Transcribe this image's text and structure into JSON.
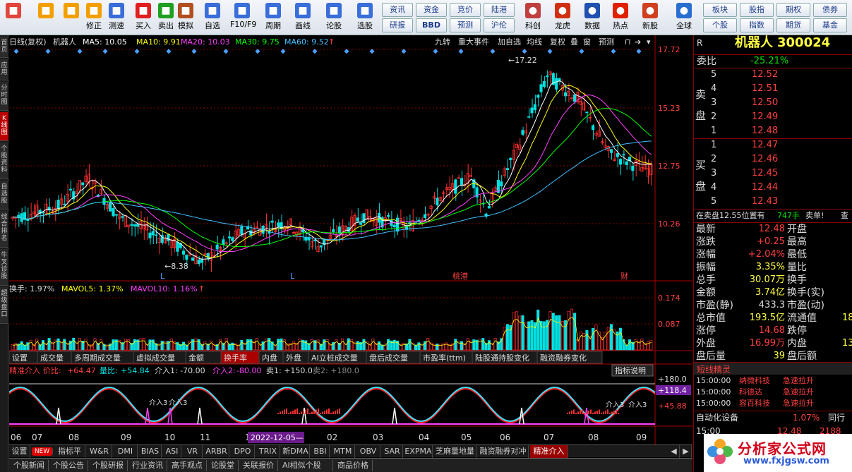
{
  "toolbar": {
    "buttons": [
      {
        "label": "",
        "icon": "app-grid-icon",
        "color": "#e2453c"
      },
      {
        "label": "",
        "icon": "back-arrow-icon",
        "color": "#f2a000"
      },
      {
        "label": "",
        "icon": "up-down-arrow-icon",
        "color": "#f2a000"
      },
      {
        "label": "修正",
        "icon": "refresh-icon",
        "color": "#f2a000"
      },
      {
        "label": "测速",
        "icon": "clock-icon",
        "color": "#3a6ed8"
      },
      {
        "label": "买入",
        "icon": "buy-icon",
        "color": "#e02020"
      },
      {
        "label": "卖出",
        "icon": "sell-icon",
        "color": "#20a020"
      },
      {
        "label": "模拟",
        "icon": "hammer-icon",
        "color": "#b05020"
      },
      {
        "label": "自选",
        "icon": "star-folder-icon",
        "color": "#3a6ed8"
      },
      {
        "label": "F10/F9",
        "icon": "f10-icon",
        "color": "#3a6ed8"
      },
      {
        "label": "周期",
        "icon": "period-icon",
        "color": "#3a6ed8"
      },
      {
        "label": "画线",
        "icon": "pencil-icon",
        "color": "#3a6ed8"
      },
      {
        "label": "论股",
        "icon": "discuss-icon",
        "color": "#3a6ed8"
      },
      {
        "label": "选股",
        "icon": "stock-pick-icon",
        "color": "#3a6ed8"
      }
    ],
    "tags_row1": [
      "资讯",
      "资金",
      "竞价",
      "陆港"
    ],
    "tags_row2": [
      "研报",
      "BBD",
      "预测",
      "沪伦"
    ],
    "buttons2": [
      {
        "label": "科创",
        "icon": "tech-board-icon"
      },
      {
        "label": "龙虎",
        "icon": "dragon-tiger-icon"
      },
      {
        "label": "数据",
        "icon": "pe-data-icon"
      },
      {
        "label": "热点",
        "icon": "hot-icon"
      },
      {
        "label": "新股",
        "icon": "new-stock-icon"
      },
      {
        "label": "全球",
        "icon": "globe-icon"
      }
    ],
    "tags2_row1": [
      "板块",
      "股指",
      "期权",
      "债券"
    ],
    "tags2_row2": [
      "个股",
      "指数",
      "期货",
      "基金"
    ]
  },
  "left_tabs": [
    "首页",
    "应用",
    "分时图",
    "K线图",
    "个股资料",
    "自选股",
    "综合排名",
    "牛叉诊股",
    "超级盘口"
  ],
  "chart": {
    "header_left": "日线(复权)",
    "stock_name": "机器人",
    "ma5": "MA5: 10.05",
    "ma10": "MA10: 9.91",
    "ma20": "MA20: 10.03",
    "ma30": "MA30: 9.75",
    "ma60": "MA60: 9.52",
    "header_right": [
      "九转",
      "重大事件",
      "加自选",
      "均线",
      "复权",
      "叠",
      "窗",
      "预测"
    ],
    "price_axis": [
      "17.72",
      "15.23",
      "12.75",
      "10.26"
    ],
    "high_label": "17.22",
    "low_label": "8.38",
    "markers": [
      "L",
      "L",
      "桃港",
      "财"
    ],
    "colors": {
      "ma5": "#ffffff",
      "ma10": "#ffff00",
      "ma20": "#ff40ff",
      "ma30": "#00ff00",
      "ma60": "#40c0ff",
      "up": "#ff3030",
      "down": "#00e0e0"
    }
  },
  "volume": {
    "label": "换手: 1.97%",
    "mavol5": "MAVOL5: 1.37%",
    "mavol10": "MAVOL10: 1.16%",
    "axis": [
      "0.174",
      "0.087"
    ]
  },
  "subtabs": [
    "设置",
    "成交量",
    "多周期成交量",
    "虚拟成交量",
    "金额",
    "换手率",
    "内盘",
    "外盘",
    "AI立桩成交量",
    "盘后成交量",
    "市盈率(ttm)",
    "陆股通持股变化",
    "融资融券变化"
  ],
  "indicator": {
    "name": "精准介入",
    "price_ratio_label": "价比:",
    "price_ratio": "+64.47",
    "vol_ratio_label": "量比:",
    "vol_ratio": "+54.84",
    "entry1": "介入1: -70.00",
    "entry2_label": "介入2:",
    "entry2": "-80.00",
    "sell1": "卖1: +150.0",
    "sell2": "卖2: +180.0",
    "explain": "指标说明",
    "axis": [
      "+180.0",
      "+118.4",
      "+45.88"
    ],
    "annotation": "介入3"
  },
  "time_axis": [
    "06",
    "07",
    "08",
    "09",
    "10",
    "11",
    "12",
    "01",
    "02",
    "03",
    "04",
    "05",
    "06",
    "07",
    "08",
    "09"
  ],
  "date_tooltip": "2022-12-05",
  "bottom_tabs": [
    "设置",
    "NEW",
    "指标平台",
    "W&R",
    "DMI",
    "BIAS",
    "ASI",
    "VR",
    "ARBR",
    "DPO",
    "TRIX",
    "新DMA",
    "BBI",
    "MTM",
    "OBV",
    "SAR",
    "EXPMA",
    "芝麻量地量",
    "融资融券对冲",
    "精准介入"
  ],
  "bottom2": [
    "个股新闻",
    "个股公告",
    "个股研报",
    "行业资讯",
    "高手观点",
    "论股堂",
    "关联报价",
    "AI相似个股",
    "商品价格"
  ],
  "right": {
    "r": "R",
    "name": "机器人",
    "code": "300024",
    "weibi_label": "委比",
    "weibi": "-25.21%",
    "sell_label": "卖盘",
    "buy_label": "买盘",
    "asks": [
      [
        "5",
        "12.52"
      ],
      [
        "4",
        "12.51"
      ],
      [
        "3",
        "12.50"
      ],
      [
        "2",
        "12.49"
      ],
      [
        "1",
        "12.48"
      ]
    ],
    "bids": [
      [
        "1",
        "12.47"
      ],
      [
        "2",
        "12.46"
      ],
      [
        "3",
        "12.45"
      ],
      [
        "4",
        "12.44"
      ],
      [
        "5",
        "12.43"
      ]
    ],
    "alert": "在卖盘12.55位置有",
    "alert_qty": "747手",
    "alert_tail": "卖单!",
    "stats": [
      [
        "最新",
        "12.48",
        "开盘",
        ""
      ],
      [
        "涨跌",
        "+0.25",
        "最高",
        ""
      ],
      [
        "涨幅",
        "+2.04%",
        "最低",
        ""
      ],
      [
        "振幅",
        "3.35%",
        "量比",
        ""
      ],
      [
        "总手",
        "30.07万",
        "换手",
        ""
      ],
      [
        "金额",
        "3.74亿",
        "换手(实)",
        ""
      ],
      [
        "市盈(静)",
        "433.3",
        "市盈(动)",
        ""
      ],
      [
        "总市值",
        "193.5亿",
        "流通值",
        "18"
      ],
      [
        "涨停",
        "14.68",
        "跌停",
        ""
      ],
      [
        "外盘",
        "16.99万",
        "内盘",
        "13"
      ],
      [
        "盘后量",
        "39",
        "盘后额",
        ""
      ]
    ],
    "short_title": "短线精灵",
    "short_rows": [
      [
        "15:00:00",
        "纳微科技",
        "急速拉升"
      ],
      [
        "15:00:00",
        "科德达",
        "急速拉升"
      ],
      [
        "15:00:00",
        "容百科技",
        "急速拉升"
      ]
    ],
    "auto_label": "自动化设备",
    "auto_val": "1.07%",
    "auto_tail": "同行",
    "last_time": "15:00",
    "last_price": "12.48",
    "last_vol": "2188"
  },
  "watermark": {
    "cn": "分析家公式网",
    "url": "www.fxjgsw.com"
  }
}
